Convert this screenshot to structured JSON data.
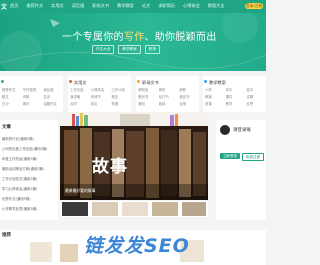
{
  "header": {
    "logo_text": "文",
    "nav": [
      "首页",
      "推荐作文",
      "实用文",
      "读后感",
      "职场文书",
      "教学教案",
      "论文",
      "求职简历",
      "心得体会",
      "教案大全"
    ],
    "login_label": "登录/注册"
  },
  "hero": {
    "slogan_prefix": "一个专属你的",
    "slogan_highlight": "写作",
    "slogan_suffix": "、助你脱颖而出",
    "chips": [
      "作文大全",
      "教学教案",
      "职场"
    ]
  },
  "categories": [
    {
      "title": "",
      "color": "#2eb88f",
      "links": [
        "推荐作文",
        "写作指导",
        "读后感",
        "散文",
        "诗歌",
        "名言",
        "日记",
        "周记",
        "话题作文"
      ]
    },
    {
      "title": "实用文",
      "color": "#e85a3b",
      "links": [
        "工作总结",
        "心得体会",
        "工作计划",
        "演讲稿",
        "申请书",
        "报告",
        "合同",
        "协议",
        "条据"
      ]
    },
    {
      "title": "职场文书",
      "color": "#f0a23a",
      "links": [
        "求职信",
        "简历",
        "辞职",
        "策划书",
        "检讨书",
        "倡议书",
        "通知",
        "致辞",
        "证明"
      ]
    },
    {
      "title": "教学教案",
      "color": "#3aa0e8",
      "links": [
        "小学",
        "初中",
        "高中",
        "教案",
        "课件",
        "试题",
        "说课",
        "教学",
        "反思"
      ]
    }
  ],
  "left_panel": {
    "title": "文章",
    "items": [
      "最新的行业(通用5篇)",
      "公司的月度工作总结(通用5篇)",
      "年度工作总结(通用5篇)",
      "最新活动策划方案(通用5篇)",
      "工作计划范文(通用5篇)",
      "学习心得体会(通用5篇)",
      "优秀作文(通用5篇)",
      "小学教学反思(通用5篇)",
      "工作报告范文(通用5篇)",
      "教学计划(通用5篇)"
    ]
  },
  "main": {
    "big_text": "故事",
    "caption": "最美最好看的故事"
  },
  "user": {
    "welcome": "请登录账",
    "btn_login": "立即登录",
    "btn_register": "免费注册"
  },
  "bottom": {
    "title": "推荐"
  },
  "watermark": "链发发SEO",
  "colors": {
    "brand": "#1fa583",
    "login_button": "#ffd84d",
    "watermark": "#3c86d8"
  }
}
